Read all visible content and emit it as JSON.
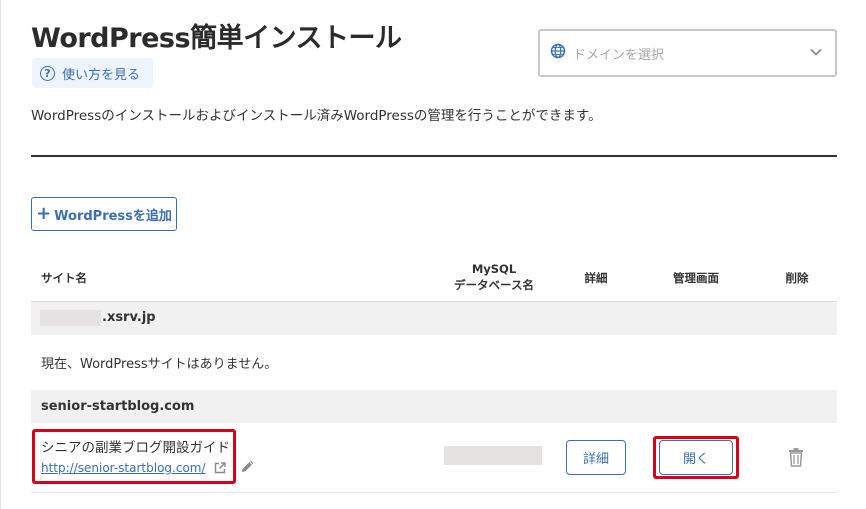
{
  "header": {
    "title": "WordPress簡単インストール",
    "help_label": "使い方を見る",
    "domain_placeholder": "ドメインを選択"
  },
  "description": "WordPressのインストールおよびインストール済みWordPressの管理を行うことができます。",
  "add_button_label": "WordPressを追加",
  "table": {
    "columns": {
      "site_name": "サイト名",
      "mysql_line1": "MySQL",
      "mysql_line2": "データベース名",
      "detail": "詳細",
      "admin": "管理画面",
      "delete": "削除"
    },
    "groups": [
      {
        "domain": ".xsrv.jp",
        "empty_message": "現在、WordPressサイトはありません。"
      },
      {
        "domain": "senior-startblog.com",
        "sites": [
          {
            "name": "シニアの副業ブログ開設ガイド",
            "url": "http://senior-startblog.com/",
            "detail_label": "詳細",
            "open_label": "開く"
          }
        ]
      }
    ]
  },
  "colors": {
    "accent": "#3b6fb0",
    "highlight": "#d9001b",
    "group_bg": "#f1f1f1"
  },
  "icons": [
    "help-icon",
    "globe-icon",
    "chevron-down-icon",
    "plus-icon",
    "external-link-icon",
    "pencil-icon",
    "trash-icon"
  ]
}
